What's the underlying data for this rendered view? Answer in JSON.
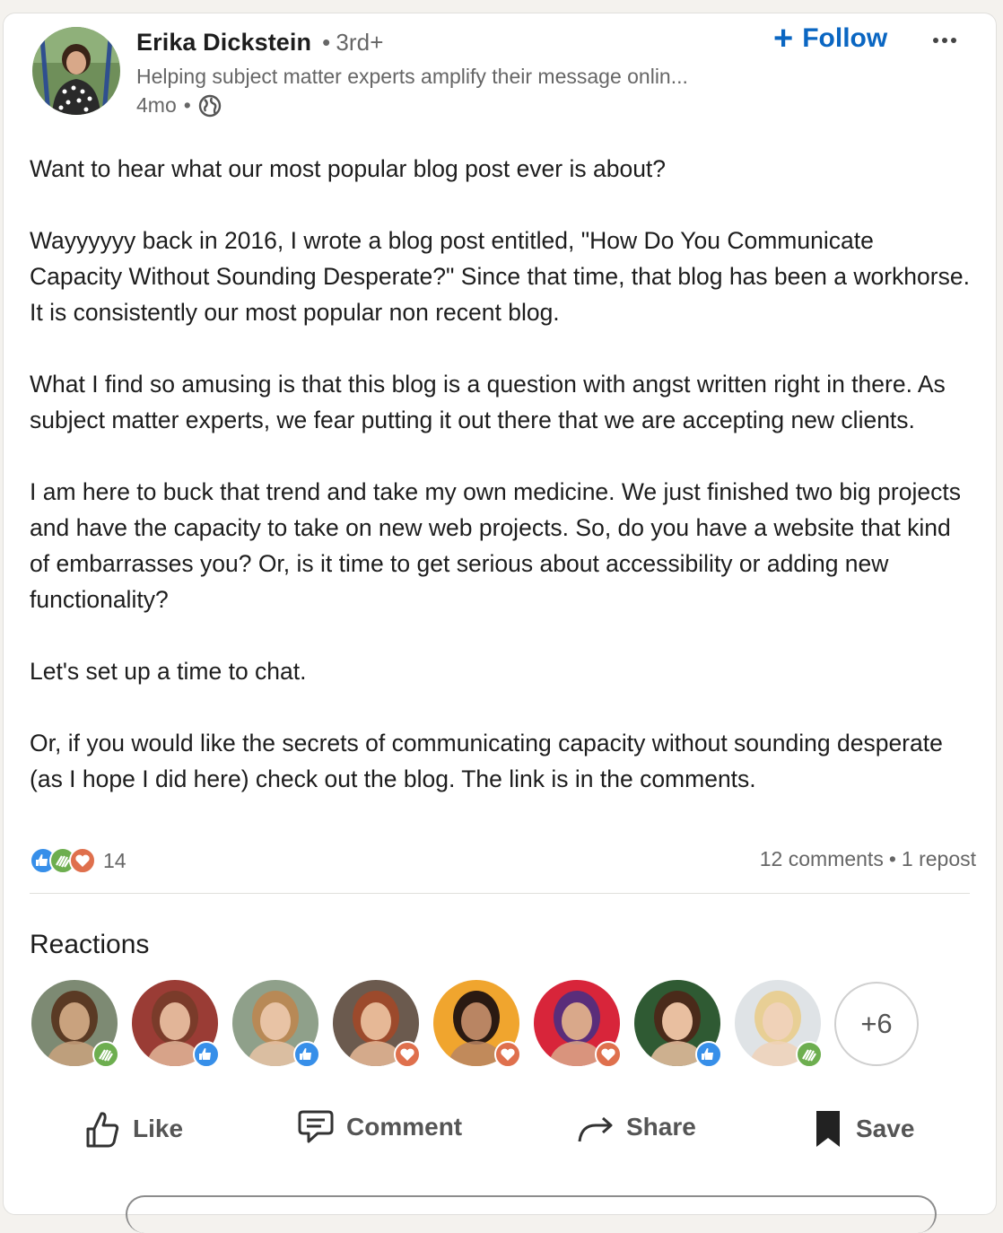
{
  "author": {
    "name": "Erika Dickstein",
    "degree": "3rd+",
    "headline": "Helping subject matter experts amplify their message onlin...",
    "time_ago": "4mo"
  },
  "follow_label": "Follow",
  "post": {
    "paragraphs": [
      "Want to hear what our most popular blog post ever is about?",
      "Wayyyyyy back in 2016, I wrote a blog post entitled, \"How Do You Communicate Capacity Without Sounding Desperate?\" Since that time, that blog has been a workhorse. It is consistently our most popular non recent blog.",
      "What I find so amusing is that this blog is a question with angst written right in there. As subject matter experts, we fear putting it out there that we are accepting new clients.",
      "I am here to buck that trend and take my own medicine. We just finished two big projects and have the capacity to take on new web projects. So, do you have a website that kind of embarrasses you? Or, is it time to get serious about accessibility or adding new functionality?",
      "Let's set up a time to chat.",
      "Or, if you would like the secrets of communicating capacity without sounding desperate (as I hope I did here) check out the blog. The link is in the comments."
    ]
  },
  "social": {
    "reaction_count": "14",
    "comments": "12 comments",
    "reposts": "1 repost",
    "reaction_icons": [
      "like-icon",
      "support-icon",
      "love-icon"
    ]
  },
  "reactions": {
    "title": "Reactions",
    "more_label": "+6",
    "reactors": [
      {
        "badge": "support",
        "skin": "#c9a27e",
        "hair": "#5a3a24",
        "bg": "#7d8a73"
      },
      {
        "badge": "like",
        "skin": "#e2b598",
        "hair": "#7a3b2a",
        "bg": "#9a3c35"
      },
      {
        "badge": "like",
        "skin": "#e8c3a5",
        "hair": "#b88956",
        "bg": "#8fa08a"
      },
      {
        "badge": "love",
        "skin": "#e6b896",
        "hair": "#9c4a2c",
        "bg": "#6b5a4e"
      },
      {
        "badge": "love",
        "skin": "#b98563",
        "hair": "#2a1a12",
        "bg": "#f0a52e"
      },
      {
        "badge": "love",
        "skin": "#d9a88a",
        "hair": "#5a2d7a",
        "bg": "#d8253a"
      },
      {
        "badge": "like",
        "skin": "#e9bfa0",
        "hair": "#4a2a1a",
        "bg": "#2f5a33"
      },
      {
        "badge": "support",
        "skin": "#f0d2b8",
        "hair": "#e8cf95",
        "bg": "#dfe3e6"
      }
    ]
  },
  "actions": {
    "like": "Like",
    "comment": "Comment",
    "share": "Share",
    "save": "Save"
  },
  "colors": {
    "accent": "#0a66c2",
    "like_badge": "#378fe9",
    "love_badge": "#df704d",
    "support_badge": "#6dae4f"
  }
}
